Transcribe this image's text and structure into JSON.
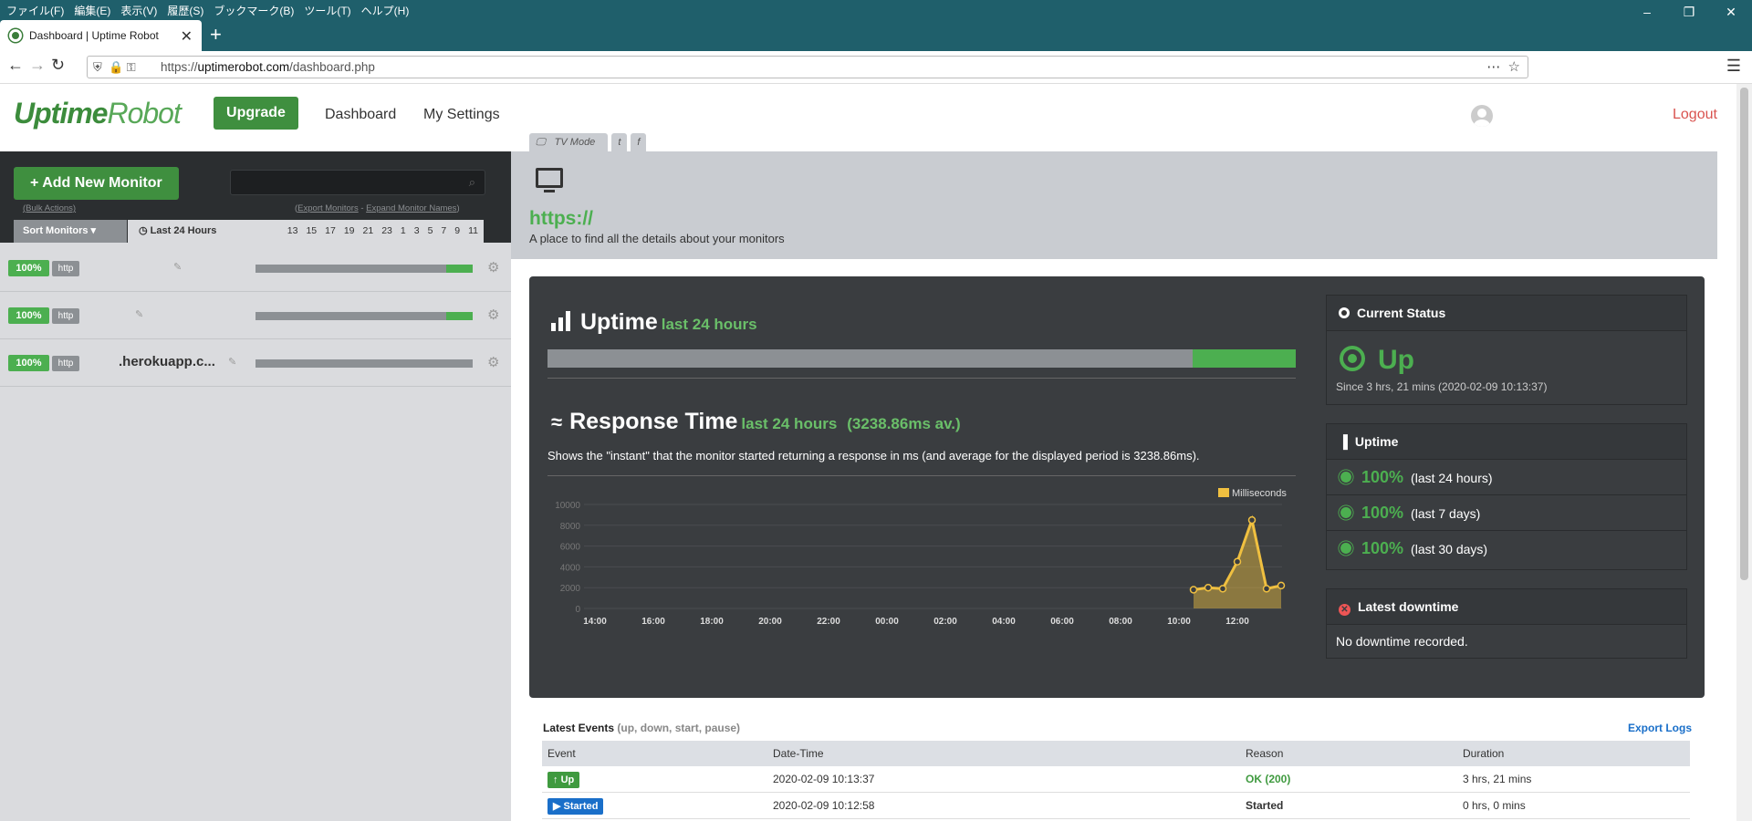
{
  "browser": {
    "menu": [
      "ファイル(F)",
      "編集(E)",
      "表示(V)",
      "履歴(S)",
      "ブックマーク(B)",
      "ツール(T)",
      "ヘルプ(H)"
    ],
    "tab_title": "Dashboard | Uptime Robot",
    "url_prefix": "https://",
    "url_host": "uptimerobot.com",
    "url_path": "/dashboard.php"
  },
  "header": {
    "logo_a": "Uptime",
    "logo_b": "Robot",
    "upgrade": "Upgrade",
    "nav": [
      "Dashboard",
      "My Settings"
    ],
    "logout": "Logout",
    "tv_mode": "TV Mode"
  },
  "sidebar": {
    "add_monitor": "Add New Monitor",
    "bulk_actions": "(Bulk Actions)",
    "export_monitors": "Export Monitors",
    "expand_names": "Expand Monitor Names",
    "sort": "Sort Monitors",
    "last24": "Last 24 Hours",
    "hours": [
      "13",
      "15",
      "17",
      "19",
      "21",
      "23",
      "1",
      "3",
      "5",
      "7",
      "9",
      "11"
    ],
    "monitors": [
      {
        "pct": "100%",
        "type": "http",
        "name": "",
        "up_fraction": 0.12
      },
      {
        "pct": "100%",
        "type": "http",
        "name": "",
        "up_fraction": 0.12
      },
      {
        "pct": "100%",
        "type": "http",
        "name": ".herokuapp.c...",
        "up_fraction": 0
      }
    ]
  },
  "banner": {
    "title": "https://",
    "subtitle": "A place to find all the details about your monitors"
  },
  "uptime": {
    "title": "Uptime",
    "period": "last 24 hours",
    "up_fraction": 0.138
  },
  "response": {
    "title": "Response Time",
    "period": "last 24 hours",
    "avg": "(3238.86ms av.)",
    "desc": "Shows the \"instant\" that the monitor started returning a response in ms (and average for the displayed period is 3238.86ms)."
  },
  "status": {
    "current_title": "Current Status",
    "state": "Up",
    "since": "Since 3 hrs, 21 mins (2020-02-09 10:13:37)",
    "uptime_title": "Uptime",
    "uptime_rows": [
      {
        "pct": "100%",
        "label": "(last 24 hours)"
      },
      {
        "pct": "100%",
        "label": "(last 7 days)"
      },
      {
        "pct": "100%",
        "label": "(last 30 days)"
      }
    ],
    "downtime_title": "Latest downtime",
    "downtime_text": "No downtime recorded."
  },
  "events": {
    "title": "Latest Events",
    "filters": "(up, down, start, pause)",
    "export": "Export Logs",
    "headers": [
      "Event",
      "Date-Time",
      "Reason",
      "Duration"
    ],
    "rows": [
      {
        "event": "Up",
        "datetime": "2020-02-09 10:13:37",
        "reason": "OK (200)",
        "duration": "3 hrs, 21 mins"
      },
      {
        "event": "Started",
        "datetime": "2020-02-09 10:12:58",
        "reason": "Started",
        "duration": "0 hrs, 0 mins"
      }
    ]
  },
  "chart_data": {
    "type": "area",
    "legend": "Milliseconds",
    "xlabel": "",
    "ylabel": "",
    "ylim": [
      0,
      10000
    ],
    "yticks": [
      0,
      2000,
      4000,
      6000,
      8000,
      10000
    ],
    "xticks": [
      "14:00",
      "16:00",
      "18:00",
      "20:00",
      "22:00",
      "00:00",
      "02:00",
      "04:00",
      "06:00",
      "08:00",
      "10:00",
      "12:00"
    ],
    "x_hours": [
      10.5,
      11.0,
      11.5,
      12.0,
      12.5,
      13.0,
      13.5
    ],
    "values": [
      1800,
      2000,
      1900,
      4500,
      8500,
      1900,
      2200
    ],
    "color": "#f0c040"
  }
}
